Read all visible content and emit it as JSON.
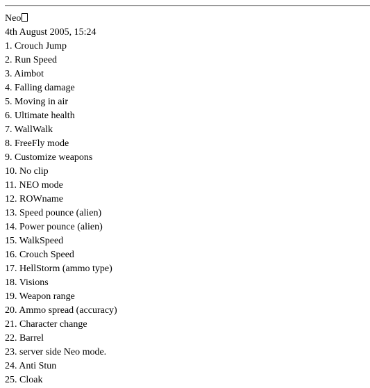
{
  "post": {
    "author": "Neo",
    "author_suffix_glyph": "missing-glyph-box",
    "date": "4th August 2005, 15:24",
    "items": [
      "1. Crouch Jump",
      "2. Run Speed",
      "3. Aimbot",
      "4. Falling damage",
      "5. Moving in air",
      "6. Ultimate health",
      "7. WallWalk",
      "8. FreeFly mode",
      "9. Customize weapons",
      "10. No clip",
      "11. NEO mode",
      "12. ROWname",
      "13. Speed pounce (alien)",
      "14. Power pounce (alien)",
      "15. WalkSpeed",
      "16. Crouch Speed",
      "17. HellStorm (ammo type)",
      "18. Visions",
      "19. Weapon range",
      "20. Ammo spread (accuracy)",
      "21. Character change",
      "22. Barrel",
      "23. server side Neo mode.",
      "24. Anti Stun",
      "25. Cloak"
    ]
  }
}
